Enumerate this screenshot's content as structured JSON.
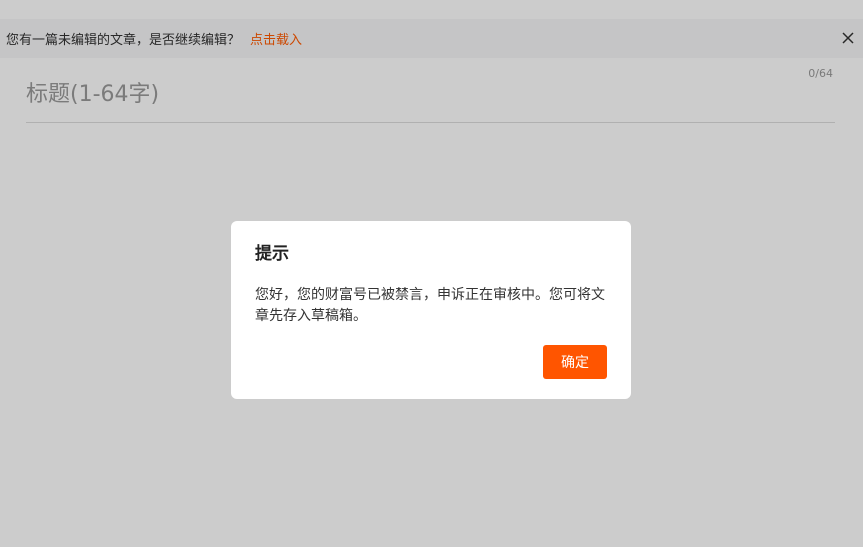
{
  "notice": {
    "text": "您有一篇未编辑的文章，是否继续编辑？",
    "link_label": "点击载入",
    "close_icon": "close-icon"
  },
  "editor": {
    "title_placeholder": "标题(1-64字)",
    "title_value": "",
    "title_counter": "0/64"
  },
  "dialog": {
    "title": "提示",
    "message": "您好，您的财富号已被禁言，申诉正在审核中。您可将文章先存入草稿箱。",
    "confirm_label": "确定"
  },
  "colors": {
    "accent": "#ff5500",
    "link": "#ff5a00",
    "overlay": "rgba(0,0,0,0.2)"
  }
}
